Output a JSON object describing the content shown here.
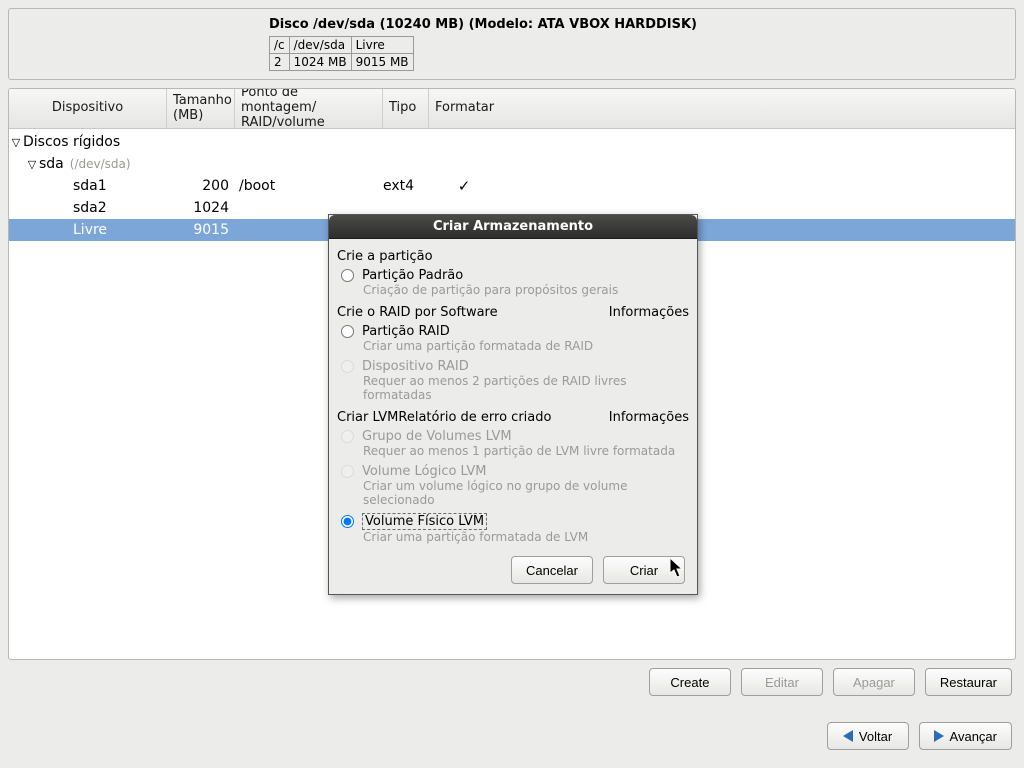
{
  "disk_legend": {
    "title": "Disco /dev/sda (10240 MB) (Modelo: ATA VBOX HARDDISK)",
    "rows": [
      [
        "/c",
        "/dev/sda",
        "Livre"
      ],
      [
        "2",
        "1024 MB",
        "9015 MB"
      ]
    ]
  },
  "columns": {
    "device": "Dispositivo",
    "size": "Tamanho (MB)",
    "mount": "Ponto de montagem/ RAID/volume",
    "type": "Tipo",
    "format": "Formatar"
  },
  "tree": {
    "root_label": "Discos rígidos",
    "disk_label": "sda",
    "disk_hint": "(/dev/sda)",
    "rows": [
      {
        "dev": "sda1",
        "size": "200",
        "mount": "/boot",
        "type": "ext4",
        "fmt": true,
        "sel": false
      },
      {
        "dev": "sda2",
        "size": "1024",
        "mount": "",
        "type": "",
        "fmt": false,
        "sel": false
      },
      {
        "dev": "Livre",
        "size": "9015",
        "mount": "",
        "type": "",
        "fmt": false,
        "sel": true
      }
    ]
  },
  "buttons": {
    "create": "Create",
    "edit": "Editar",
    "delete": "Apagar",
    "restore": "Restaurar",
    "back": "Voltar",
    "next": "Avançar"
  },
  "dialog": {
    "title": "Criar Armazenamento",
    "sec1": "Crie a partição",
    "opt_std": "Partição Padrão",
    "opt_std_desc": "Criação de partição para propósitos gerais",
    "sec2": "Crie o RAID por Software",
    "info": "Informações",
    "opt_raid_part": "Partição RAID",
    "opt_raid_part_desc": "Criar uma partição formatada de RAID",
    "opt_raid_dev": "Dispositivo RAID",
    "opt_raid_dev_desc": "Requer ao menos 2 partições de RAID livres formatadas",
    "sec3a": "Criar LVM",
    "sec3b": "Relatório de erro criado",
    "opt_vg": "Grupo de Volumes LVM",
    "opt_vg_desc": "Requer ao menos 1 partição de LVM livre formatada",
    "opt_lv": "Volume Lógico LVM",
    "opt_lv_desc": "Criar um volume lógico no grupo de volume selecionado",
    "opt_pv": "Volume Físico LVM",
    "opt_pv_desc": "Criar uma partição formatada de LVM",
    "cancel": "Cancelar",
    "create": "Criar"
  }
}
